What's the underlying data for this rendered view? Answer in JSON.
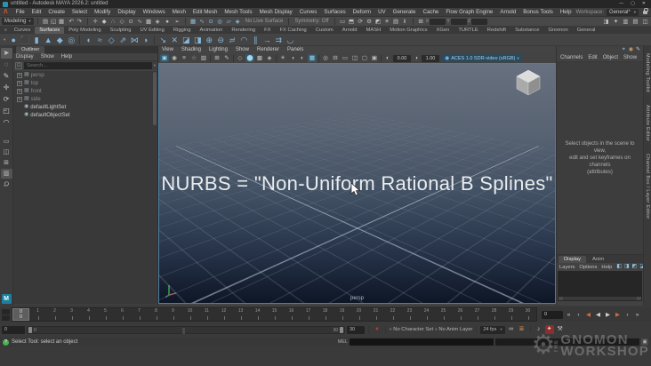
{
  "window": {
    "title": "untitled - Autodesk MAYA 2026.2: untitled",
    "minimize": "—",
    "maximize": "▢",
    "close": "✕"
  },
  "menu_bar": {
    "logo_glyph": "Λ",
    "items": [
      "File",
      "Edit",
      "Create",
      "Select",
      "Modify",
      "Display",
      "Windows",
      "Mesh",
      "Edit Mesh",
      "Mesh Tools",
      "Mesh Display",
      "Curves",
      "Surfaces",
      "Deform",
      "UV",
      "Generate",
      "Cache",
      "Flow Graph Engine",
      "Arnold",
      "Bonus Tools",
      "Help"
    ],
    "workspace_label": "Workspace:",
    "workspace_value": "General*",
    "workspace_caret": "▾"
  },
  "status_line": {
    "menu_set": "Modeling",
    "menu_set_caret": "▾",
    "file_icons": [
      {
        "name": "new-scene-icon",
        "glyph": "▤"
      },
      {
        "name": "open-scene-icon",
        "glyph": "◱"
      },
      {
        "name": "save-scene-icon",
        "glyph": "▦"
      }
    ],
    "history_icons": [
      {
        "name": "undo-icon",
        "glyph": "↶"
      },
      {
        "name": "redo-icon",
        "glyph": "↷"
      }
    ],
    "mask_icons": [
      {
        "name": "select-hierarchy-icon",
        "glyph": "✛",
        "active": true
      },
      {
        "name": "select-object-icon",
        "glyph": "◆",
        "active": true
      },
      {
        "name": "select-component-icon",
        "glyph": "∴",
        "active": true
      },
      {
        "name": "select-handles-icon",
        "glyph": "◇",
        "active": true
      },
      {
        "name": "select-joints-icon",
        "glyph": "⊙",
        "active": true
      },
      {
        "name": "select-curves-icon",
        "glyph": "∿",
        "active": true
      },
      {
        "name": "select-surfaces-icon",
        "glyph": "▩",
        "active": true
      },
      {
        "name": "select-deformations-icon",
        "glyph": "◈",
        "active": true
      }
    ],
    "lock_icon": {
      "name": "lock-selection-icon",
      "glyph": "●"
    },
    "highlight_icon": {
      "name": "highlight-selection-icon",
      "glyph": "➢"
    },
    "snap_icons": [
      {
        "name": "snap-to-grids-icon",
        "glyph": "▦"
      },
      {
        "name": "snap-to-curves-icon",
        "glyph": "∿"
      },
      {
        "name": "snap-to-points-icon",
        "glyph": "⊙"
      },
      {
        "name": "snap-to-projected-center-icon",
        "glyph": "◎"
      },
      {
        "name": "snap-to-view-planes-icon",
        "glyph": "▱"
      },
      {
        "name": "make-live-icon",
        "glyph": "◈"
      }
    ],
    "live_surface": "No Live Surface",
    "symmetry": "Symmetry: Off",
    "render_icons": [
      {
        "name": "open-render-view-icon",
        "glyph": "▭"
      },
      {
        "name": "render-current-frame-icon",
        "glyph": "⬒"
      },
      {
        "name": "ipr-render-icon",
        "glyph": "⟳"
      },
      {
        "name": "render-settings-icon",
        "glyph": "⚙"
      },
      {
        "name": "hypershade-icon",
        "glyph": "◩"
      },
      {
        "name": "light-editor-icon",
        "glyph": "☀"
      },
      {
        "name": "render-setup-icon",
        "glyph": "▤"
      },
      {
        "name": "pause-viewport-icon",
        "glyph": "‖"
      }
    ],
    "grid_icon": {
      "name": "input-line-icon",
      "glyph": "⊞"
    },
    "xyz": {
      "x": "X",
      "y": "Y",
      "z": "Z"
    },
    "panel_toggle_icons": [
      {
        "name": "toggle-modeling-toolkit-icon",
        "glyph": "◨"
      },
      {
        "name": "toggle-character-controls-icon",
        "glyph": "✦"
      },
      {
        "name": "toggle-attribute-editor-icon",
        "glyph": "▥"
      },
      {
        "name": "toggle-tool-settings-icon",
        "glyph": "▤"
      },
      {
        "name": "toggle-channel-box-icon",
        "glyph": "◫"
      }
    ]
  },
  "shelf": {
    "burger": "≡",
    "menu_caret": "▾",
    "tabs": [
      {
        "label": "Curves"
      },
      {
        "label": "Surfaces",
        "active": true
      },
      {
        "label": "Poly Modeling"
      },
      {
        "label": "Sculpting"
      },
      {
        "label": "UV Editing"
      },
      {
        "label": "Rigging"
      },
      {
        "label": "Animation"
      },
      {
        "label": "Rendering"
      },
      {
        "label": "FX"
      },
      {
        "label": "FX Caching"
      },
      {
        "label": "Custom"
      },
      {
        "label": "Arnold"
      },
      {
        "label": "MASH"
      },
      {
        "label": "Motion Graphics"
      },
      {
        "label": "XGen"
      },
      {
        "label": "TURTLE"
      },
      {
        "label": "Redshift"
      },
      {
        "label": "Substance"
      },
      {
        "label": "Gnomon"
      },
      {
        "label": "General"
      }
    ],
    "icons": [
      {
        "name": "nurbs-sphere-icon",
        "glyph": "●"
      },
      {
        "name": "nurbs-cube-icon",
        "glyph": "⬛"
      },
      {
        "name": "nurbs-cylinder-icon",
        "glyph": "▮"
      },
      {
        "name": "nurbs-cone-icon",
        "glyph": "▲"
      },
      {
        "name": "nurbs-plane-icon",
        "glyph": "◆"
      },
      {
        "name": "nurbs-torus-icon",
        "glyph": "◎"
      },
      {
        "sep": true
      },
      {
        "name": "revolve-icon",
        "glyph": "◖"
      },
      {
        "name": "loft-icon",
        "glyph": "≈"
      },
      {
        "name": "planar-icon",
        "glyph": "◇"
      },
      {
        "name": "extrude-icon",
        "glyph": "⇗"
      },
      {
        "name": "birail-icon",
        "glyph": "⋈"
      },
      {
        "name": "boundary-icon",
        "glyph": "◗"
      },
      {
        "sep": true
      },
      {
        "name": "project-curve-icon",
        "glyph": "↘"
      },
      {
        "name": "intersect-surfaces-icon",
        "glyph": "✕"
      },
      {
        "name": "trim-tool-icon",
        "glyph": "◪"
      },
      {
        "name": "untrim-icon",
        "glyph": "◨"
      },
      {
        "name": "attach-surfaces-icon",
        "glyph": "⊕"
      },
      {
        "name": "detach-surfaces-icon",
        "glyph": "⊖"
      },
      {
        "name": "align-surfaces-icon",
        "glyph": "≓"
      },
      {
        "name": "open-close-surfaces-icon",
        "glyph": "◠"
      },
      {
        "name": "insert-isoparms-icon",
        "glyph": "∥"
      },
      {
        "name": "extend-surfaces-icon",
        "glyph": "→"
      },
      {
        "name": "offset-surfaces-icon",
        "glyph": "⇉"
      },
      {
        "name": "surface-fillet-icon",
        "glyph": "◡"
      }
    ]
  },
  "toolbox": {
    "tools": [
      {
        "name": "select-tool-icon",
        "glyph": "➤",
        "active": true
      },
      {
        "name": "lasso-tool-icon",
        "glyph": "◌"
      },
      {
        "name": "paint-select-tool-icon",
        "glyph": "✎"
      },
      {
        "name": "move-tool-icon",
        "glyph": "✛"
      },
      {
        "name": "rotate-tool-icon",
        "glyph": "⟳"
      },
      {
        "name": "scale-tool-icon",
        "glyph": "◰"
      },
      {
        "name": "curve-tool-icon",
        "glyph": "◠"
      }
    ],
    "layouts": [
      {
        "name": "single-pane-layout-button",
        "glyph": "▭"
      },
      {
        "name": "two-pane-layout-button",
        "glyph": "◫"
      },
      {
        "name": "four-pane-layout-button",
        "glyph": "⊞"
      },
      {
        "name": "outliner-persp-layout-button",
        "glyph": "▥",
        "active": true
      }
    ],
    "magnifier_glyph": "Ϙ",
    "m_logo": "M"
  },
  "outliner": {
    "tab": "Outliner",
    "menus": [
      "Display",
      "Show",
      "Help"
    ],
    "filter_glyph": "⊡",
    "search_placeholder": "Search...",
    "search_caret": "▾",
    "items": [
      {
        "name": "outliner-item-persp",
        "label": "persp",
        "glyph": "▦",
        "muted": true
      },
      {
        "name": "outliner-item-top",
        "label": "top",
        "glyph": "▦",
        "muted": true
      },
      {
        "name": "outliner-item-front",
        "label": "front",
        "glyph": "▦",
        "muted": true
      },
      {
        "name": "outliner-item-side",
        "label": "side",
        "glyph": "▦",
        "muted": true
      },
      {
        "name": "outliner-item-defaultlightset",
        "label": "defaultLightSet",
        "glyph": "◉",
        "set": true
      },
      {
        "name": "outliner-item-defaultobjectset",
        "label": "defaultObjectSet",
        "glyph": "◉",
        "set": true
      }
    ]
  },
  "viewport": {
    "menus": [
      "View",
      "Shading",
      "Lighting",
      "Show",
      "Renderer",
      "Panels"
    ],
    "toolbar_icons": [
      {
        "name": "select-camera-icon",
        "glyph": "▣",
        "active": true
      },
      {
        "name": "lock-camera-icon",
        "glyph": "◉"
      },
      {
        "name": "camera-attributes-icon",
        "glyph": "≡"
      },
      {
        "name": "bookmarks-icon",
        "glyph": "☆"
      },
      {
        "name": "image-plane-icon",
        "glyph": "▨"
      },
      {
        "sep": true
      },
      {
        "name": "two-d-pan-zoom-icon",
        "glyph": "⊞"
      },
      {
        "name": "grease-pencil-icon",
        "glyph": "✎"
      },
      {
        "sep": true
      },
      {
        "name": "wireframe-icon",
        "glyph": "◇"
      },
      {
        "name": "shaded-icon",
        "glyph": "⬤",
        "active": true
      },
      {
        "name": "textured-icon",
        "glyph": "▩"
      },
      {
        "name": "wireframe-on-shaded-icon",
        "glyph": "◈"
      },
      {
        "sep": true
      },
      {
        "name": "use-all-lights-icon",
        "glyph": "☀"
      },
      {
        "name": "shadows-icon",
        "glyph": "◑"
      },
      {
        "name": "ambient-occlusion-icon",
        "glyph": "◐"
      },
      {
        "name": "multisample-aa-icon",
        "glyph": "▦",
        "active": true
      },
      {
        "sep": true
      },
      {
        "name": "isolate-select-icon",
        "glyph": "◎"
      },
      {
        "name": "field-chart-icon",
        "glyph": "⊟"
      },
      {
        "name": "resolution-gate-icon",
        "glyph": "▭"
      },
      {
        "name": "gate-mask-icon",
        "glyph": "◫"
      },
      {
        "name": "safe-action-icon",
        "glyph": "▢"
      },
      {
        "name": "safe-title-icon",
        "glyph": "▣"
      },
      {
        "sep": true
      },
      {
        "name": "exposure-icon",
        "glyph": "◐"
      }
    ],
    "gamma_icon": {
      "name": "gamma-icon",
      "glyph": "◑"
    },
    "exposure": "0.00",
    "gamma": "1.00",
    "colorspace_dot": "◉",
    "colorspace": "ACES 1.0 SDR-video (sRGB)",
    "colorspace_caret": "▾",
    "overlay_text": "NURBS = \"Non-Uniform Rational B Splines\"",
    "camera_label": "persp"
  },
  "channel_box": {
    "toolbar_icons": [
      {
        "name": "character-icon",
        "glyph": "✦",
        "color": "#6aa0c8"
      },
      {
        "name": "color-wheel-icon",
        "glyph": "◉",
        "color": "#c8a06a"
      },
      {
        "name": "pencil-icon",
        "glyph": "✎",
        "color": "#c8c8c8"
      }
    ],
    "menus": [
      "Channels",
      "Edit",
      "Object",
      "Show"
    ],
    "message": "Select objects in the scene to view,\nedit and set keyframes on channels\n(attributes)"
  },
  "side_tabs": [
    "Modeling Toolkit",
    "Attribute Editor",
    "Channel Box / Layer Editor"
  ],
  "layer_editor": {
    "tabs": [
      {
        "label": "Display",
        "active": true
      },
      {
        "label": "Anim"
      }
    ],
    "menus": [
      "Layers",
      "Options",
      "Help"
    ],
    "icons": [
      {
        "name": "new-empty-layer-icon",
        "glyph": "◧"
      },
      {
        "name": "new-layer-from-selected-icon",
        "glyph": "◨"
      },
      {
        "name": "new-layer-move-selected-icon",
        "glyph": "◩"
      },
      {
        "name": "new-layer-icon",
        "glyph": "◪"
      }
    ]
  },
  "timeline": {
    "ticks": [
      "0",
      "1",
      "2",
      "3",
      "4",
      "5",
      "6",
      "7",
      "8",
      "9",
      "10",
      "11",
      "12",
      "13",
      "14",
      "15",
      "16",
      "17",
      "18",
      "19",
      "20",
      "21",
      "22",
      "23",
      "24",
      "25",
      "26",
      "27",
      "28",
      "29",
      "30"
    ],
    "current_frame": "0",
    "time_field": "0",
    "playback": [
      {
        "name": "go-to-start-button",
        "glyph": "«"
      },
      {
        "name": "step-back-frame-button",
        "glyph": "‹"
      },
      {
        "name": "step-back-key-button",
        "glyph": "◀",
        "color": "#cc6a43"
      },
      {
        "name": "play-backwards-button",
        "glyph": "◀"
      },
      {
        "name": "play-forwards-button",
        "glyph": "▶"
      },
      {
        "name": "step-forward-key-button",
        "glyph": "▶",
        "color": "#cc6a43"
      },
      {
        "name": "step-forward-frame-button",
        "glyph": "›"
      },
      {
        "name": "go-to-end-button",
        "glyph": "»"
      }
    ]
  },
  "range_slider": {
    "start_field": "0",
    "handle_start": "0",
    "handle_end": "30",
    "end_field": "30",
    "set_key_glyph": "♦",
    "character_set": "No Character Set",
    "anim_layer": "No Anim Layer",
    "caret": "▾",
    "fps": "24 fps",
    "loop_glyph": "∞",
    "cached_glyph": "≣",
    "mute_glyph": "♪",
    "autokey_glyph": "✦",
    "prefs_glyph": "⚒"
  },
  "help_line": {
    "text": "Select Tool: select an object"
  },
  "command_line": {
    "mel_label": "MEL",
    "script_editor_glyph": "▣"
  },
  "watermark": {
    "the": "THE",
    "line1": "GNOMON",
    "line2": "WORKSHOP"
  },
  "colors": {
    "accent": "#5285a6",
    "nurbs_icon": "#86b8dc",
    "autokey_red": "#8c2e2e",
    "viewport_border": "#4f7ea0"
  }
}
